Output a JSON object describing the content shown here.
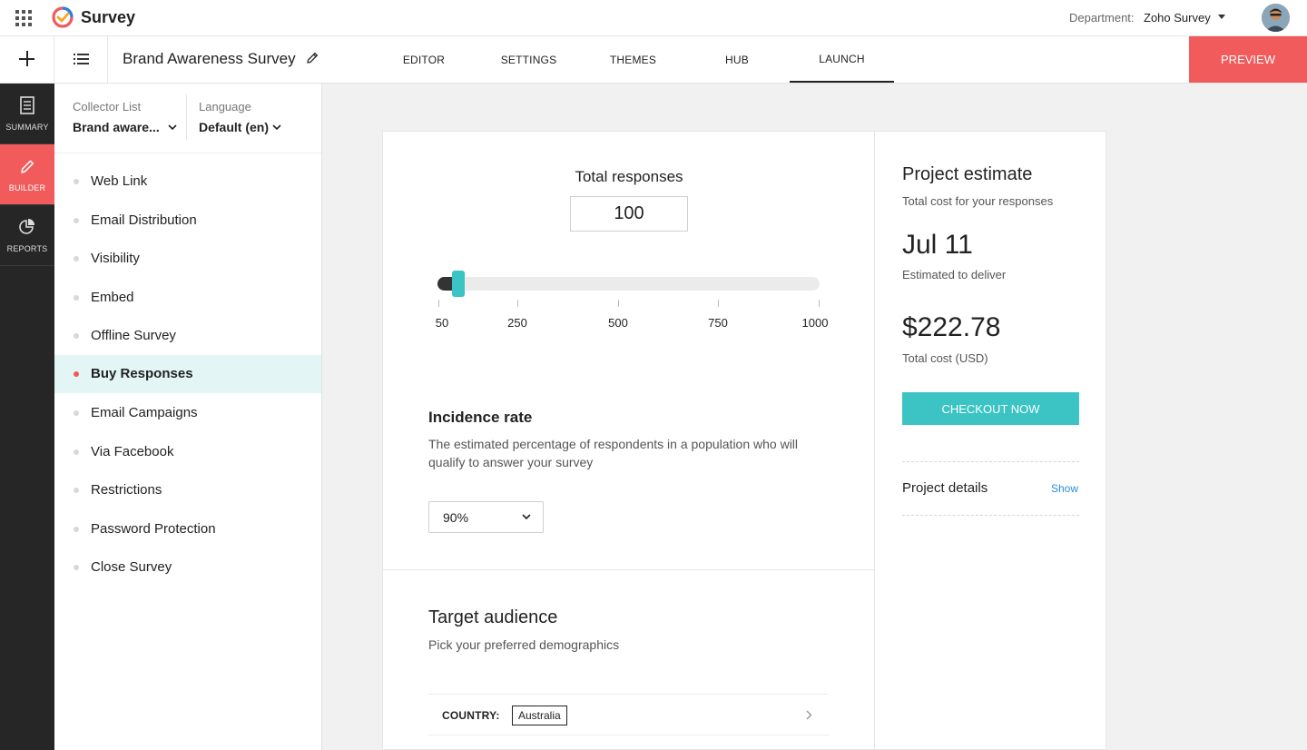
{
  "topbar": {
    "app_name": "Survey",
    "department_label": "Department:",
    "department_value": "Zoho Survey"
  },
  "subbar": {
    "survey_title": "Brand Awareness Survey",
    "tabs": [
      {
        "label": "EDITOR"
      },
      {
        "label": "SETTINGS"
      },
      {
        "label": "THEMES"
      },
      {
        "label": "HUB"
      },
      {
        "label": "LAUNCH",
        "active": true
      }
    ],
    "preview_label": "PREVIEW"
  },
  "darkbar": {
    "items": [
      {
        "label": "SUMMARY",
        "icon": "document-icon"
      },
      {
        "label": "BUILDER",
        "icon": "pencil-icon",
        "active": true
      },
      {
        "label": "REPORTS",
        "icon": "pie-chart-icon"
      }
    ]
  },
  "panel": {
    "collector_label": "Collector List",
    "collector_value": "Brand aware...",
    "language_label": "Language",
    "language_value": "Default (en)",
    "items": [
      {
        "label": "Web Link"
      },
      {
        "label": "Email Distribution"
      },
      {
        "label": "Visibility"
      },
      {
        "label": "Embed"
      },
      {
        "label": "Offline Survey"
      },
      {
        "label": "Buy Responses",
        "active": true
      },
      {
        "label": "Email Campaigns"
      },
      {
        "label": "Via Facebook"
      },
      {
        "label": "Restrictions"
      },
      {
        "label": "Password Protection"
      },
      {
        "label": "Close Survey"
      }
    ]
  },
  "responses": {
    "label": "Total responses",
    "value": "100",
    "slider": {
      "min": 50,
      "max": 1000,
      "value": 100,
      "ticks": [
        "50",
        "250",
        "500",
        "750",
        "1000"
      ]
    }
  },
  "incidence": {
    "title": "Incidence rate",
    "description": "The estimated percentage of respondents in a population who will qualify to answer your survey",
    "selected": "90%"
  },
  "audience": {
    "title": "Target audience",
    "description": "Pick your preferred demographics",
    "country_label": "COUNTRY:",
    "country_value": "Australia"
  },
  "estimate": {
    "title": "Project estimate",
    "subtitle": "Total cost for your responses",
    "date": "Jul 11",
    "date_label": "Estimated to deliver",
    "cost": "$222.78",
    "cost_label": "Total cost (USD)",
    "checkout_label": "CHECKOUT NOW",
    "details_label": "Project details",
    "details_link": "Show"
  },
  "colors": {
    "accent_red": "#f15b5b",
    "accent_teal": "#3cc3c3",
    "link_blue": "#2a8fd6"
  }
}
